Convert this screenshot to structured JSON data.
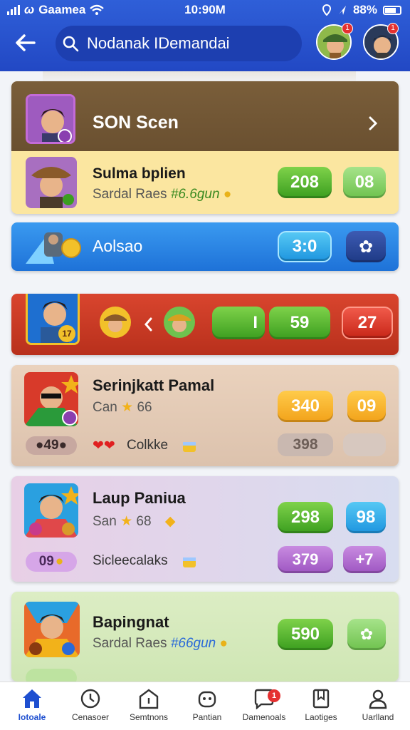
{
  "status_bar": {
    "carrier": "Gaamea",
    "time": "10:90M",
    "battery": "88%"
  },
  "header": {
    "search_text": "Nodanak IDemandai",
    "badge_1": "1",
    "badge_2": "1"
  },
  "cards": [
    {
      "title": "SON Scen"
    },
    {
      "title": "Sulma bplien",
      "subtitle": "Sardal Raes",
      "sub_extra": "#6.6gun",
      "stat_1": "208",
      "stat_2": "08"
    },
    {
      "title": "Aolsao",
      "stat_1": "3:0",
      "stat_2": ""
    },
    {
      "badge_1": "17",
      "bar_left": "I",
      "stat_1": "59",
      "stat_2": "27"
    },
    {
      "title": "Serinjkatt Pamal",
      "subtitle": "Can",
      "sub_value": "66",
      "chip_1": "49",
      "hearts_label": "Colkke",
      "stat_1": "340",
      "stat_2": "09",
      "stat_3": "398"
    },
    {
      "title": "Laup Paniua",
      "subtitle": "San",
      "sub_value": "68",
      "chip_1": "09",
      "extra_label": "Sicleecalaks",
      "stat_1": "298",
      "stat_2": "98",
      "stat_3": "379",
      "stat_4": "+7"
    },
    {
      "title": "Bapingnat",
      "subtitle": "Sardal Raes",
      "sub_extra": "#66gun",
      "stat_1": "590",
      "stat_2": ""
    }
  ],
  "nav": [
    {
      "label": "Iotoale"
    },
    {
      "label": "Cenasoer"
    },
    {
      "label": "Semtnons"
    },
    {
      "label": "Pantian"
    },
    {
      "label": "Damenoals",
      "badge": "1"
    },
    {
      "label": "Laotiges"
    },
    {
      "label": "Uarlland"
    }
  ],
  "colors": {
    "header_blue": "#2248c4",
    "accent_green": "#3b9e1f",
    "nav_active": "#1e4fd0"
  }
}
